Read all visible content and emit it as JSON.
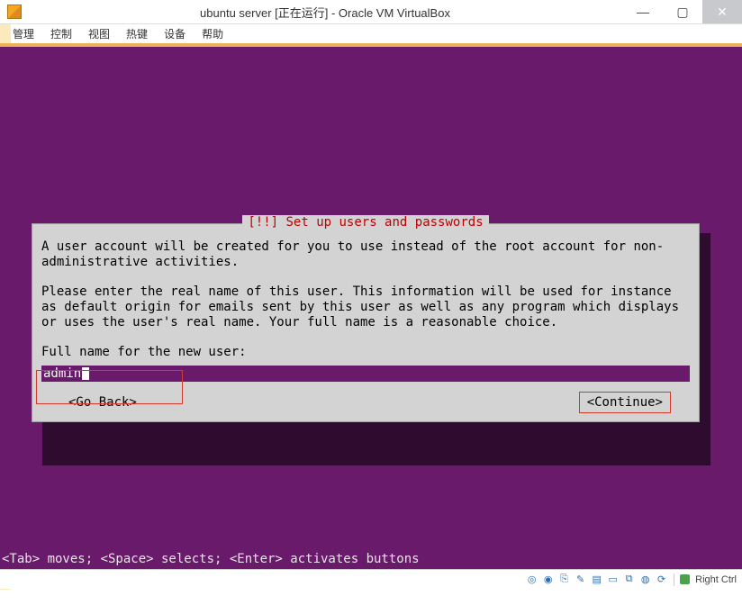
{
  "window": {
    "title": "ubuntu server [正在运行] - Oracle VM VirtualBox",
    "min": "—",
    "max": "▢",
    "close": "✕"
  },
  "menu": {
    "items": [
      "管理",
      "控制",
      "视图",
      "热键",
      "设备",
      "帮助"
    ]
  },
  "installer": {
    "heading": "[!!] Set up users and passwords",
    "para1": "A user account will be created for you to use instead of the root account for non-administrative activities.",
    "para2": "Please enter the real name of this user. This information will be used for instance as default origin for emails sent by this user as well as any program which displays or uses the user's real name. Your full name is a reasonable choice.",
    "prompt": "Full name for the new user:",
    "input_value": "admin",
    "go_back": "<Go Back>",
    "continue": "<Continue>",
    "hint": "<Tab> moves; <Space> selects; <Enter> activates buttons"
  },
  "statusbar": {
    "host_key": "Right Ctrl"
  }
}
